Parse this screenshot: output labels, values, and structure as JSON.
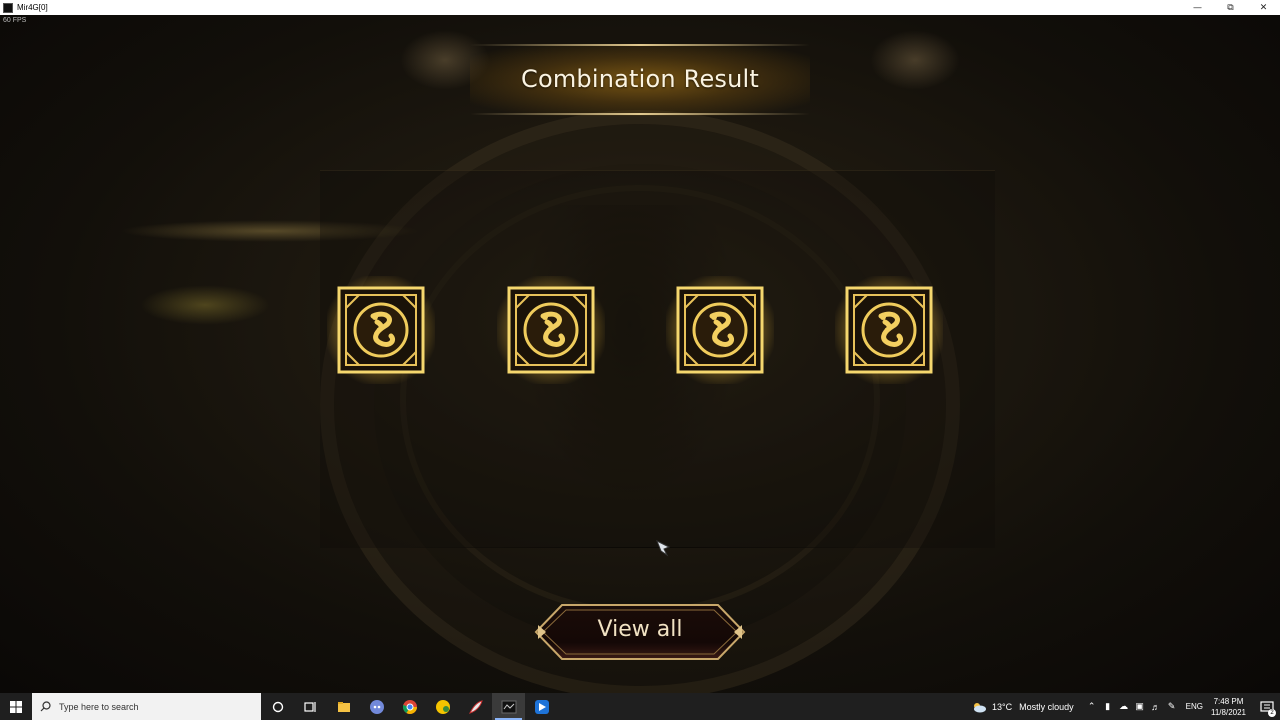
{
  "window": {
    "title": "Mir4G[0]",
    "minimize_icon": "minimize-icon",
    "restore_icon": "restore-icon",
    "close_icon": "close-icon"
  },
  "game": {
    "fps_label": "60 FPS",
    "header": {
      "title": "Combination Result"
    },
    "items": [
      {
        "icon": "dragon-emblem-icon"
      },
      {
        "icon": "dragon-emblem-icon"
      },
      {
        "icon": "dragon-emblem-icon"
      },
      {
        "icon": "dragon-emblem-icon"
      }
    ],
    "view_all_label": "View all",
    "colors": {
      "gold": "#e8c25a",
      "title": "#fbf4e2",
      "button_text": "#f1e2c3"
    }
  },
  "taskbar": {
    "search_placeholder": "Type here to search",
    "pinned": [
      "cortana-icon",
      "task-view-icon",
      "file-explorer-icon",
      "discord-icon",
      "chrome-icon",
      "app-yellow-icon",
      "app-feather-icon",
      "mir4-icon",
      "app-blue-icon"
    ],
    "weather": {
      "temp": "13°C",
      "condition": "Mostly cloudy"
    },
    "language": "ENG",
    "time": "7:48 PM",
    "date": "11/8/2021",
    "notification_count": "2"
  }
}
